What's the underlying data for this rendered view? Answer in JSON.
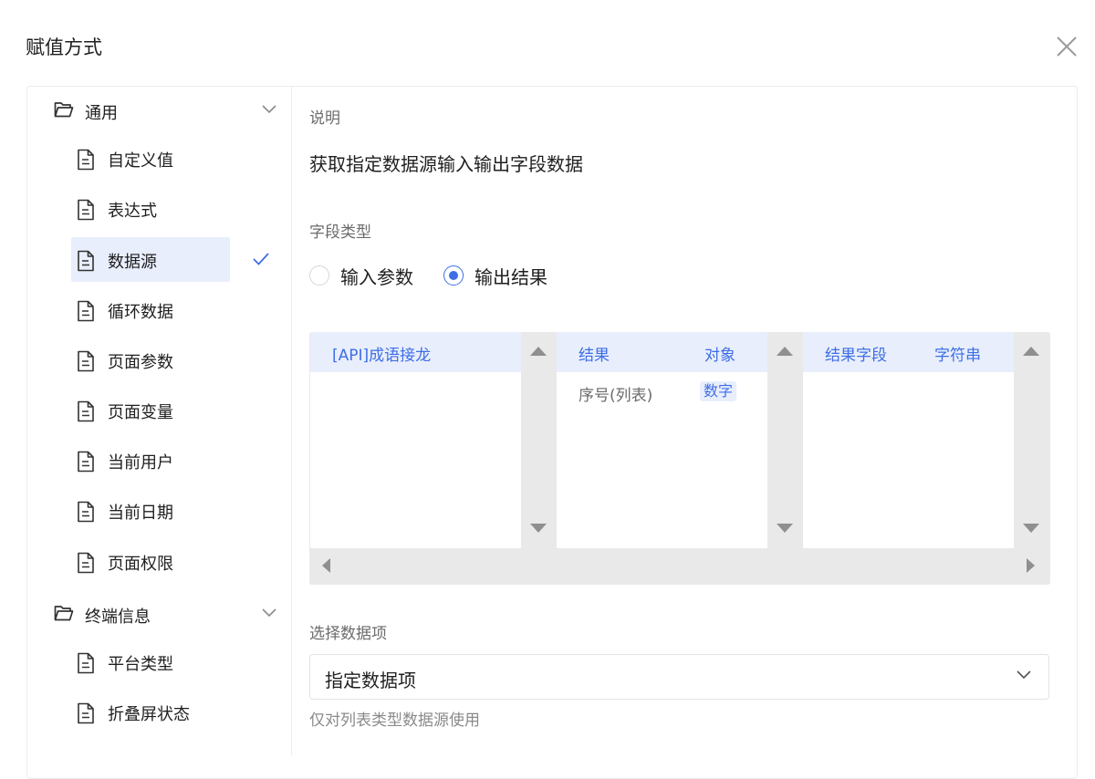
{
  "dialog": {
    "title": "赋值方式"
  },
  "sidebar": {
    "groups": [
      {
        "label": "通用",
        "items": [
          "自定义值",
          "表达式",
          "数据源",
          "循环数据",
          "页面参数",
          "页面变量",
          "当前用户",
          "当前日期",
          "页面权限"
        ]
      },
      {
        "label": "终端信息",
        "items": [
          "平台类型",
          "折叠屏状态"
        ]
      }
    ],
    "selected_item": "数据源"
  },
  "main": {
    "description_label": "说明",
    "description_text": "获取指定数据源输入输出字段数据",
    "field_type_label": "字段类型",
    "field_type_options": [
      "输入参数",
      "输出结果"
    ],
    "field_type_selected": "输出结果",
    "cascader": {
      "col1": {
        "rows": [
          {
            "label": "[API]成语接龙"
          }
        ]
      },
      "col2": {
        "rows": [
          {
            "label": "结果",
            "type": "对象"
          },
          {
            "label": "序号(列表)",
            "type": "数字"
          }
        ]
      },
      "col3": {
        "rows": [
          {
            "label": "结果字段",
            "type": "字符串"
          }
        ]
      }
    },
    "select_label": "选择数据项",
    "select_value": "指定数据项",
    "select_hint": "仅对列表类型数据源使用"
  },
  "colors": {
    "accent": "#3e6ee6",
    "selected_bg": "#e8eefc"
  }
}
